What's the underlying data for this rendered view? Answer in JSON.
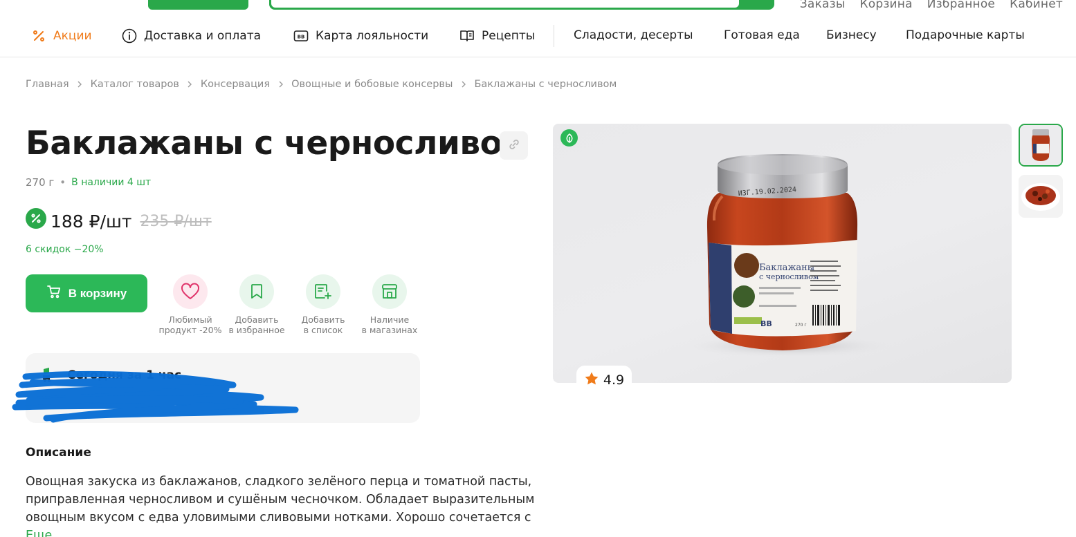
{
  "header": {
    "user_links": [
      "Заказы",
      "Корзина",
      "Избранное",
      "Кабинет"
    ]
  },
  "nav": {
    "promo": "Акции",
    "delivery": "Доставка и оплата",
    "loyalty": "Карта лояльности",
    "loyalty_badge": "ВВ",
    "recipes": "Рецепты",
    "sweets": "Сладости, десерты",
    "ready_food": "Готовая еда",
    "business": "Бизнесу",
    "gift_cards": "Подарочные карты"
  },
  "breadcrumb": [
    "Главная",
    "Каталог товаров",
    "Консервация",
    "Овощные и бобовые консервы",
    "Баклажаны с черносливом"
  ],
  "product": {
    "title": "Баклажаны с черносливом",
    "weight": "270 г",
    "stock": "В наличии 4 шт",
    "price_now": "188 ₽/шт",
    "price_old": "235 ₽/шт",
    "promo_text": "6 скидок −20%",
    "cart_label": "В корзину",
    "rating": "4.9"
  },
  "actions": [
    {
      "label": "Любимый\nпродукт -20%"
    },
    {
      "label": "Добавить\nв избранное"
    },
    {
      "label": "Добавить\nв список"
    },
    {
      "label": "Наличие\nв магазинах"
    }
  ],
  "delivery": {
    "title": "Сегодня за 1 час"
  },
  "description": {
    "title": "Описание",
    "text": "Овощная закуска из баклажанов, сладкого зелёного перца и томатной пасты, приправленная черносливом и сушёным чесночком. Обладает выразительным овощным вкусом с едва уловимыми сливовыми нотками. Хорошо сочетается с",
    "more": "Еще"
  },
  "jar_label": {
    "title_line1": "Баклажаны",
    "title_line2": "с черносливом",
    "brand": "ВВ",
    "weight": "270 г",
    "lid_date": "ИЗГ.19.02.2024"
  },
  "colors": {
    "brand_green": "#2aa84a",
    "promo_orange": "#f07b1a",
    "star_orange": "#f07b1a"
  }
}
